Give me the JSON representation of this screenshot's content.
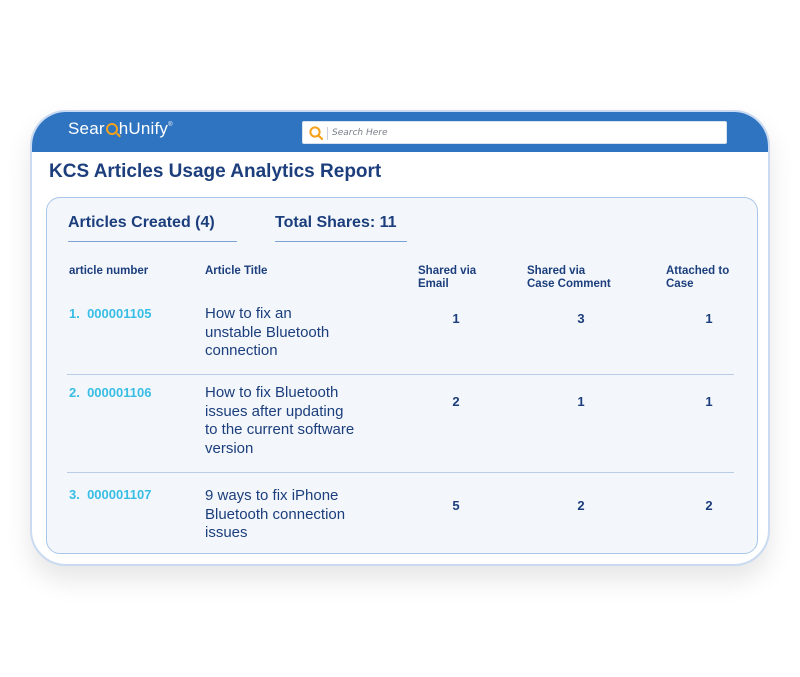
{
  "header": {
    "logo": {
      "part1": "Sear",
      "part2": "hUnify",
      "mark": "®"
    },
    "search": {
      "placeholder": "Search Here",
      "value": ""
    }
  },
  "report": {
    "title": "KCS Articles Usage Analytics Report",
    "tabs": [
      {
        "label": "Articles Created (4)"
      },
      {
        "label": "Total Shares: 11"
      }
    ],
    "columns": [
      "article number",
      "Article Title",
      "Shared via\nEmail",
      "Shared via\nCase Comment",
      "Attached to\nCase"
    ],
    "rows": [
      {
        "index": "1.",
        "number": "000001105",
        "title": "How to fix an\nunstable Bluetooth\nconnection",
        "email": "1",
        "case_comment": "3",
        "attached": "1"
      },
      {
        "index": "2.",
        "number": "000001106",
        "title": "How to fix Bluetooth\nissues after updating\nto the current software\nversion",
        "email": "2",
        "case_comment": "1",
        "attached": "1"
      },
      {
        "index": "3.",
        "number": "000001107",
        "title": " 9 ways to fix iPhone\nBluetooth connection\nissues",
        "email": "5",
        "case_comment": "2",
        "attached": "2"
      }
    ]
  },
  "colors": {
    "header_bar": "#2f74c0",
    "title_text": "#1c3e7c",
    "article_number": "#38bde4",
    "search_icon": "#f5a21a",
    "panel_bg": "#f3f7fc"
  },
  "icons": {
    "search": "search-icon",
    "logo_lens": "magnifier-icon"
  }
}
